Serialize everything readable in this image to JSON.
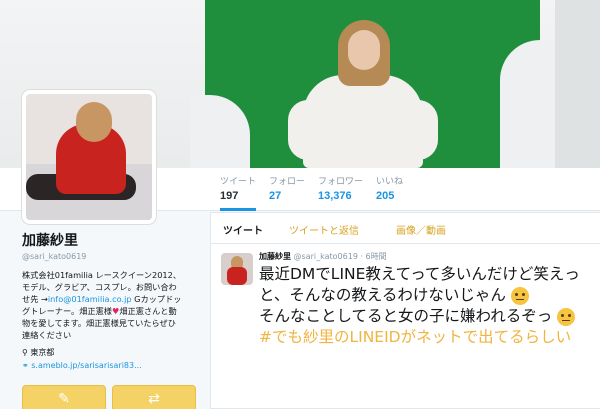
{
  "profile": {
    "name": "加藤紗里",
    "handle": "@sari_kato0619",
    "bio_line1": "株式会社01familia レースクイーン2012、モデル、グラビア、コスプレ。お問い合わせ先 →",
    "bio_link": "info@01familia.co.jp",
    "bio_line2": " Gカップドッグトレーナー。畑正憲様",
    "bio_line3": "畑正憲さんと動物を愛してます。畑正憲様見ていたらぜひ連絡ください",
    "location": "東京都",
    "url": "s.ameblo.jp/sarisarisari83..."
  },
  "stats": {
    "tweets_label": "ツイート",
    "tweets_value": "197",
    "following_label": "フォロー",
    "following_value": "27",
    "followers_label": "フォロワー",
    "followers_value": "13,376",
    "likes_label": "いいね",
    "likes_value": "205"
  },
  "tabs": {
    "tweets": "ツイート",
    "replies": "ツイートと返信",
    "media": "画像／動画"
  },
  "tweet": {
    "author": "加藤紗里",
    "handle": "@sari_kato0619",
    "time": "· 6時間",
    "line1": "最近DMでLINE教えてって多いんだけど笑えっと、そんなの教えるわけないじゃん",
    "line2": "そんなことしてると女の子に嫌われるぞっ",
    "hashtag": "#でも紗里のLINEIDがネットで出てるらしい"
  },
  "colors": {
    "accent": "#1b95e0",
    "theme_gold": "#f5d266",
    "banner_green": "#1f8f3e"
  },
  "icons": {
    "location": "location-pin-icon",
    "link": "link-icon"
  }
}
